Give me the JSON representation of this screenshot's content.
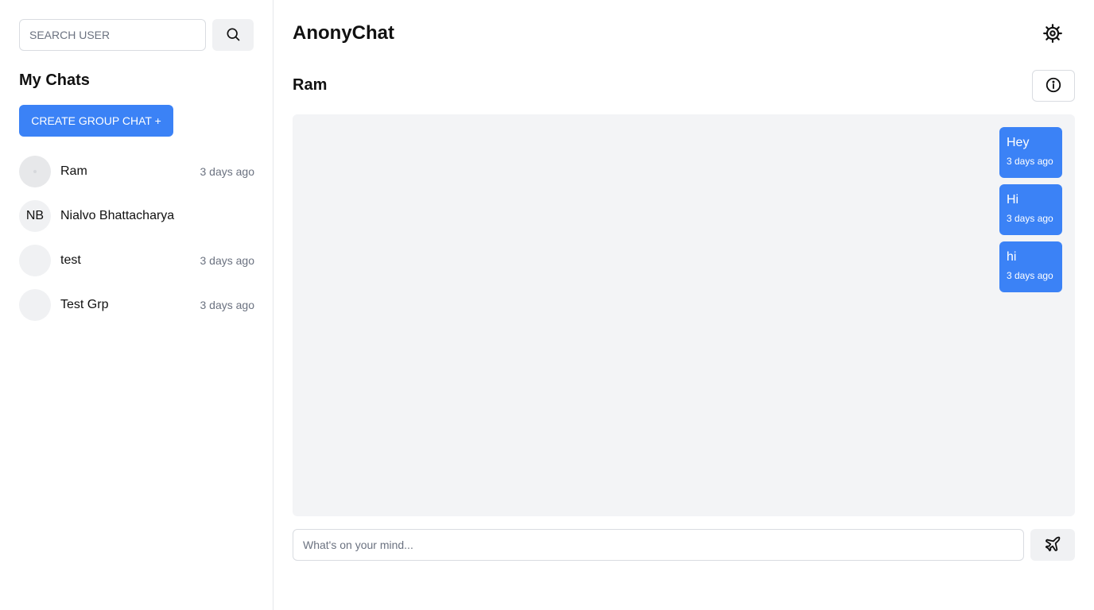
{
  "app": {
    "title": "AnonyChat"
  },
  "sidebar": {
    "search": {
      "placeholder": "SEARCH USER",
      "value": ""
    },
    "heading": "My Chats",
    "create_group_label": "CREATE GROUP CHAT +",
    "chats": [
      {
        "name": "Ram",
        "initials": "",
        "time": "3 days ago",
        "active": true
      },
      {
        "name": "Nialvo Bhattacharya",
        "initials": "NB",
        "time": "",
        "active": false
      },
      {
        "name": "test",
        "initials": "",
        "time": "3 days ago",
        "active": false
      },
      {
        "name": "Test Grp",
        "initials": "",
        "time": "3 days ago",
        "active": false
      }
    ]
  },
  "chat": {
    "name": "Ram",
    "messages": [
      {
        "text": "Hey",
        "time": "3 days ago"
      },
      {
        "text": "Hi",
        "time": "3 days ago"
      },
      {
        "text": "hi",
        "time": "3 days ago"
      }
    ],
    "composer": {
      "placeholder": "What's on your mind...",
      "value": ""
    }
  },
  "icons": {
    "search": "search-icon",
    "settings": "gear-icon",
    "info": "info-icon",
    "send": "plane-icon"
  },
  "colors": {
    "accent": "#3b82f6",
    "panel_bg": "#f3f4f6",
    "muted_text": "#6b7280"
  }
}
